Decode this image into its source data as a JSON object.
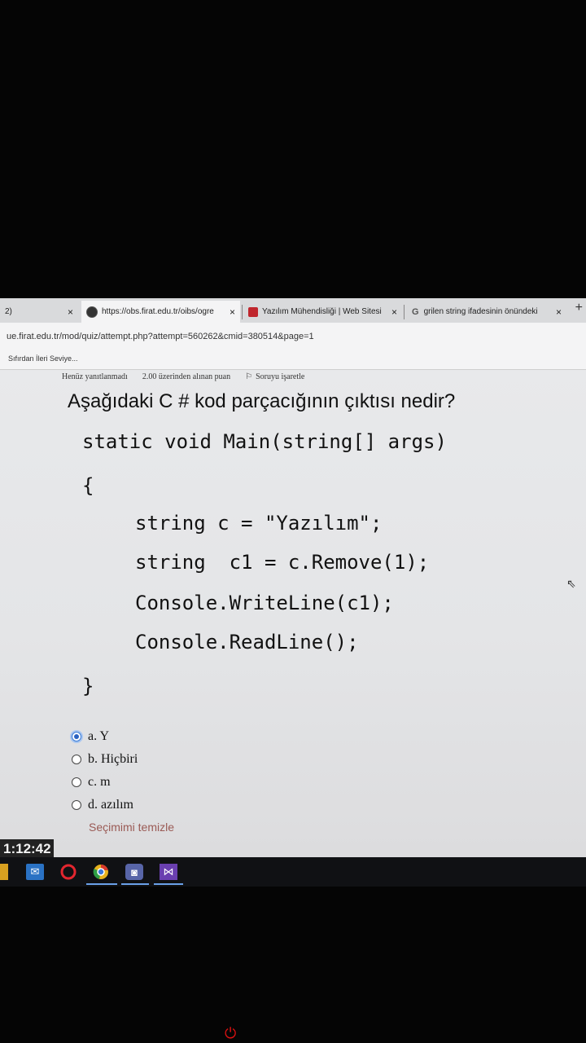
{
  "browser": {
    "tabs": [
      {
        "label": "2)",
        "close": "×"
      },
      {
        "label": "https://obs.firat.edu.tr/oibs/ogre",
        "close": "×"
      },
      {
        "label": "Yazılım Mühendisliği | Web Sitesi",
        "close": "×"
      },
      {
        "label": "grilen string ifadesinin önündeki",
        "close": "×"
      }
    ],
    "new_tab": "+",
    "url": "ue.firat.edu.tr/mod/quiz/attempt.php?attempt=560262&cmid=380514&page=1",
    "bookmark": "Sıfırdan İleri Seviye..."
  },
  "quiz": {
    "status": "Henüz yanıtlanmadı",
    "points": "2.00 üzerinden alınan puan",
    "flag": "Soruyu işaretle",
    "question": "Aşağıdaki C # kod parçacığının çıktısı nedir?",
    "code": [
      "static void Main(string[] args)",
      "{",
      "string c = \"Yazılım\";",
      "string  c1 = c.Remove(1);",
      "Console.WriteLine(c1);",
      "Console.ReadLine();",
      "}"
    ],
    "answers": [
      {
        "label": "a. Y",
        "selected": true
      },
      {
        "label": "b. Hiçbiri",
        "selected": false
      },
      {
        "label": "c. m",
        "selected": false
      },
      {
        "label": "d. azılım",
        "selected": false
      }
    ],
    "clear_choice": "Seçimimi temizle"
  },
  "clock": "1:12:42",
  "colors": {
    "accent": "#2a62c0",
    "link": "#9a5a55"
  }
}
